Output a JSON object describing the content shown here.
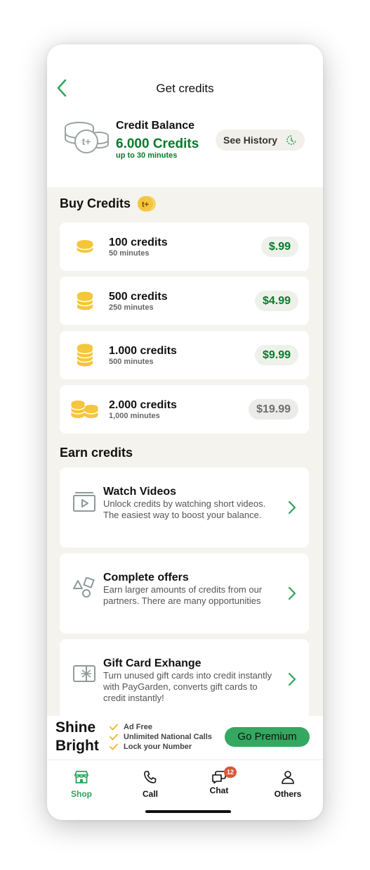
{
  "header": {
    "title": "Get credits"
  },
  "balance": {
    "label": "Credit Balance",
    "value": "6.000 Credits",
    "sub": "up to 30 minutes",
    "icon_text": "t+",
    "history_label": "See History"
  },
  "buy": {
    "title": "Buy Credits",
    "badge_text": "t+",
    "items": [
      {
        "name": "100 credits",
        "minutes": "50 minutes",
        "price": "$.99"
      },
      {
        "name": "500 credits",
        "minutes": "250 minutes",
        "price": "$4.99"
      },
      {
        "name": "1.000 credits",
        "minutes": "500 minutes",
        "price": "$9.99"
      },
      {
        "name": "2.000 credits",
        "minutes": "1,000 minutes",
        "price": "$19.99"
      }
    ]
  },
  "earn": {
    "title": "Earn credits",
    "items": [
      {
        "title": "Watch Videos",
        "desc": "Unlock credits by watching short videos. The easiest way to boost your balance.",
        "icon": "video-icon"
      },
      {
        "title": "Complete offers",
        "desc": "Earn larger amounts of credits from our partners. There are many opportunities",
        "icon": "shapes-icon"
      },
      {
        "title": "Gift Card Exhange",
        "desc": "Turn unused gift cards into credit instantly with PayGarden, converts gift cards to credit instantly!",
        "icon": "gift-card-icon"
      }
    ]
  },
  "premium": {
    "line1": "Shine",
    "line2": "Bright",
    "perks": [
      "Ad Free",
      "Unlimited National Calls",
      "Lock your Number"
    ],
    "button": "Go Premium"
  },
  "tabs": [
    {
      "label": "Shop",
      "icon": "shop-icon",
      "active": true
    },
    {
      "label": "Call",
      "icon": "phone-icon",
      "active": false
    },
    {
      "label": "Chat",
      "icon": "chat-icon",
      "active": false,
      "badge": "12"
    },
    {
      "label": "Others",
      "icon": "person-icon",
      "active": false
    }
  ],
  "colors": {
    "accent": "#2fa35a",
    "credit_green": "#0a7a2c",
    "coin": "#f5c53b",
    "badge": "#d9583a"
  }
}
